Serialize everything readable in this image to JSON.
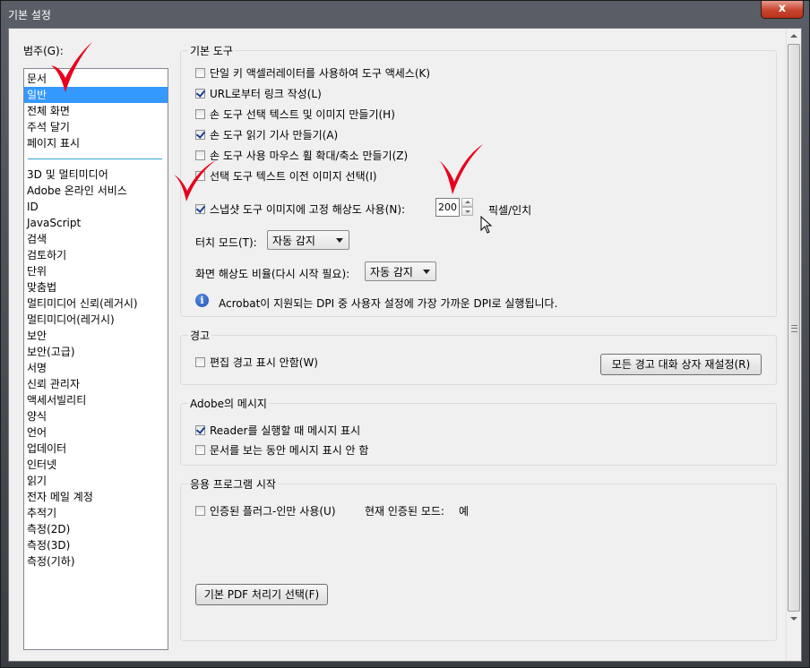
{
  "window": {
    "title": "기본 설정",
    "close": "x"
  },
  "categories": {
    "label": "범주(G):",
    "top_items": [
      "문서",
      "일반",
      "전체 화면",
      "주석 달기",
      "페이지 표시"
    ],
    "selected": "일반",
    "items": [
      "3D 및 멀티미디어",
      "Adobe 온라인 서비스",
      "ID",
      "JavaScript",
      "검색",
      "검토하기",
      "단위",
      "맞춤법",
      "멀티미디어 신뢰(레거시)",
      "멀티미디어(레거시)",
      "보안",
      "보안(고급)",
      "서명",
      "신뢰 관리자",
      "액세서빌리티",
      "양식",
      "언어",
      "업데이터",
      "인터넷",
      "읽기",
      "전자 메일 계정",
      "추적기",
      "측정(2D)",
      "측정(3D)",
      "측정(기하)"
    ]
  },
  "basic_tools": {
    "title": "기본 도구",
    "options": [
      {
        "label": "단일 키 액셀러레이터를 사용하여 도구 액세스(K)",
        "checked": false
      },
      {
        "label": "URL로부터 링크 작성(L)",
        "checked": true
      },
      {
        "label": "손 도구 선택 텍스트 및 이미지 만들기(H)",
        "checked": false
      },
      {
        "label": "손 도구 읽기 기사 만들기(A)",
        "checked": true
      },
      {
        "label": "손 도구 사용 마우스 휠 확대/축소 만들기(Z)",
        "checked": false
      },
      {
        "label": "선택 도구 텍스트 이전 이미지 선택(I)",
        "checked": false
      }
    ],
    "snapshot": {
      "label": "스냅샷 도구 이미지에 고정 해상도 사용(N):",
      "checked": true,
      "value": "200",
      "unit": "픽셀/인치"
    },
    "touch_mode": {
      "label": "터치 모드(T):",
      "value": "자동 감지"
    },
    "screen_res": {
      "label": "화면 해상도 비율(다시 시작 필요):",
      "value": "자동 감지"
    },
    "info_text": "Acrobat이 지원되는 DPI 중 사용자 설정에 가장 가까운 DPI로 실행됩니다."
  },
  "warnings": {
    "title": "경고",
    "option": {
      "label": "편집 경고 표시 안함(W)",
      "checked": false
    },
    "reset_button": "모든 경고 대화 상자 재설정(R)"
  },
  "adobe_messages": {
    "title": "Adobe의 메시지",
    "options": [
      {
        "label": "Reader를 실행할 때 메시지 표시",
        "checked": true
      },
      {
        "label": "문서를 보는 동안 메시지 표시 안 함",
        "checked": false
      }
    ]
  },
  "app_startup": {
    "title": "응용 프로그램 시작",
    "option": {
      "label": "인증된 플러그-인만 사용(U)",
      "checked": false
    },
    "cert_mode_label": "현재 인증된 모드:",
    "cert_mode_value": "예",
    "pdf_handler_button": "기본 PDF 처리기 선택(F)"
  },
  "colors": {
    "selection": "#3399ff",
    "annotation": "#e8001c"
  }
}
